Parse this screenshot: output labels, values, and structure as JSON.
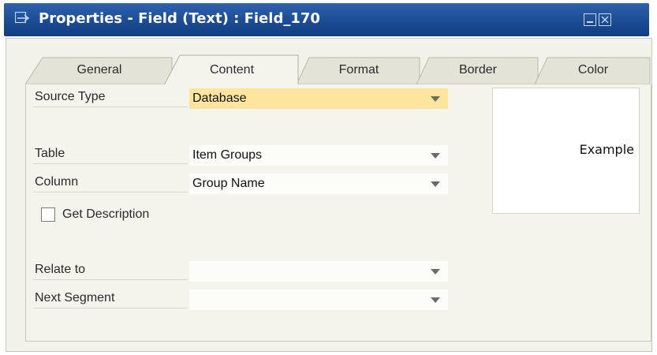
{
  "window": {
    "title": "Properties - Field (Text) : Field_170"
  },
  "tabs": [
    {
      "label": "General"
    },
    {
      "label": "Content"
    },
    {
      "label": "Format"
    },
    {
      "label": "Border"
    },
    {
      "label": "Color"
    }
  ],
  "form": {
    "source_type": {
      "label": "Source Type",
      "value": "Database"
    },
    "table": {
      "label": "Table",
      "value": "Item Groups"
    },
    "column": {
      "label": "Column",
      "value": "Group Name"
    },
    "get_description": {
      "label": "Get Description"
    },
    "relate_to": {
      "label": "Relate to",
      "value": ""
    },
    "next_segment": {
      "label": "Next Segment",
      "value": ""
    }
  },
  "preview": {
    "text": "Example"
  },
  "colors": {
    "titlebar": "#1c4c95",
    "highlight_field": "#fde59d",
    "panel_bg": "#f4f4ec"
  }
}
